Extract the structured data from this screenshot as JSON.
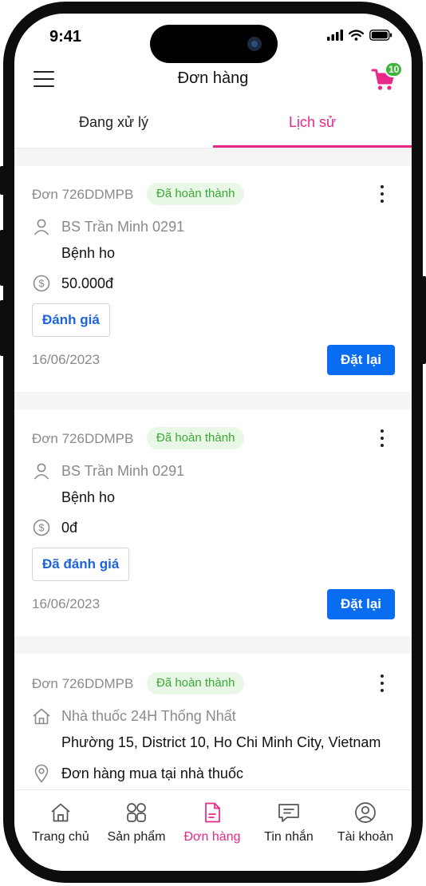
{
  "status_bar": {
    "time": "9:41"
  },
  "header": {
    "title": "Đơn hàng",
    "cart_count": "10"
  },
  "tabs": [
    {
      "label": "Đang xử lý",
      "active": false
    },
    {
      "label": "Lịch sử",
      "active": true
    }
  ],
  "orders": [
    {
      "order_no": "Đơn 726DDMPB",
      "status": "Đã hoàn thành",
      "doctor": "BS Trần Minh 0291",
      "diagnosis": "Bệnh ho",
      "amount": "50.000đ",
      "review_label": "Đánh giá",
      "date": "16/06/2023",
      "reorder_label": "Đặt lại"
    },
    {
      "order_no": "Đơn 726DDMPB",
      "status": "Đã hoàn thành",
      "doctor": "BS Trần Minh 0291",
      "diagnosis": "Bệnh ho",
      "amount": "0đ",
      "review_label": "Đã đánh giá",
      "date": "16/06/2023",
      "reorder_label": "Đặt lại"
    },
    {
      "order_no": "Đơn 726DDMPB",
      "status": "Đã hoàn thành",
      "pharmacy": "Nhà thuốc 24H Thống Nhất",
      "address": "Phường 15, District 10, Ho Chi Minh City, Vietnam",
      "purchase_note": "Đơn hàng mua tại nhà thuốc"
    }
  ],
  "bottom_nav": [
    {
      "label": "Trang chủ",
      "icon": "home-icon"
    },
    {
      "label": "Sản phẩm",
      "icon": "grid-icon"
    },
    {
      "label": "Đơn hàng",
      "icon": "document-icon",
      "active": true
    },
    {
      "label": "Tin nhắn",
      "icon": "chat-icon"
    },
    {
      "label": "Tài khoản",
      "icon": "user-circle-icon"
    }
  ],
  "colors": {
    "accent": "#e8278a",
    "primary": "#0a6cf0",
    "success": "#3aa935",
    "badge": "#3cb538"
  }
}
